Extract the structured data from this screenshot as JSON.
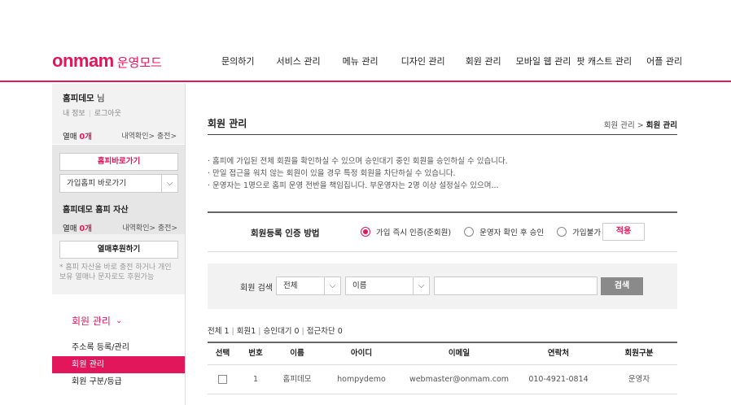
{
  "header": {
    "logo_main": "onmam",
    "logo_sub": "운영모드",
    "nav": [
      "문의하기",
      "서비스 관리",
      "메뉴 관리",
      "디자인 관리",
      "회원 관리",
      "모바일 웹 관리",
      "팟 캐스트 관리",
      "어플 관리"
    ]
  },
  "sidebar": {
    "user_name": "홈피데모",
    "user_suffix": " 님",
    "link_myinfo": "내 정보",
    "link_logout": "로그아웃",
    "yeolmae_label": "열매",
    "yeolmae_count": "0개",
    "history_charge": "내역확인> 충전>",
    "homepage_goto_button": "홈피바로가기",
    "joined_select": "가입홈피 바로가기",
    "assets_title": "홈피데모 홈피 자산",
    "assets_yeolmae_label": "열매",
    "assets_yeolmae_count": "0개",
    "assets_history_charge": "내역확인> 충전>",
    "donate_button": "열매후원하기",
    "donate_note": "* 홈피 자산을 바로 충전 하거나 개인보유 열매나 문자로도 후원가능",
    "section_title": "회원 관리",
    "menu": [
      "주소록 등록/관리",
      "회원 관리",
      "회원 구분/등급"
    ],
    "active_index": 1
  },
  "main": {
    "title": "회원 관리",
    "breadcrumb_parent": "회원 관리 > ",
    "breadcrumb_current": "회원 관리",
    "notes": [
      "홈피에 가입된 전체 회원을 확인하실 수 있으며 승인대기 중인 회원을 승인하실 수 있습니다.",
      "만일 접근을 워치 않는 회원이 있을 경우 특정 회원을 차단하실 수 있습니다.",
      "운영자는 1명으로 홈피 운영 전반을 책임집니다. 부운영자는 2명 이상 설정실수 있으며..."
    ],
    "auth_label": "회원등록 인증 방법",
    "auth_options": [
      "가입 즉시 인증(준회원)",
      "운영자 확인 후 승인",
      "가입불가"
    ],
    "auth_selected": 0,
    "apply_button": "적용",
    "search_label": "회원 검색",
    "search_scope": "전체",
    "search_field": "이름",
    "search_value": "",
    "search_button": "검색",
    "counts": {
      "total": "전체 1",
      "members": "회원1",
      "pending": "승인대기 0",
      "blocked": "접근차단 0"
    },
    "table": {
      "headers": [
        "선택",
        "번호",
        "이름",
        "아이디",
        "이메일",
        "연락처",
        "회원구분"
      ],
      "rows": [
        {
          "no": "1",
          "name": "홈피데모",
          "id": "hompydemo",
          "email": "webmaster@onmam.com",
          "phone": "010-4921-0814",
          "type": "운영자"
        }
      ]
    }
  },
  "colors": {
    "brand": "#e2175b"
  }
}
